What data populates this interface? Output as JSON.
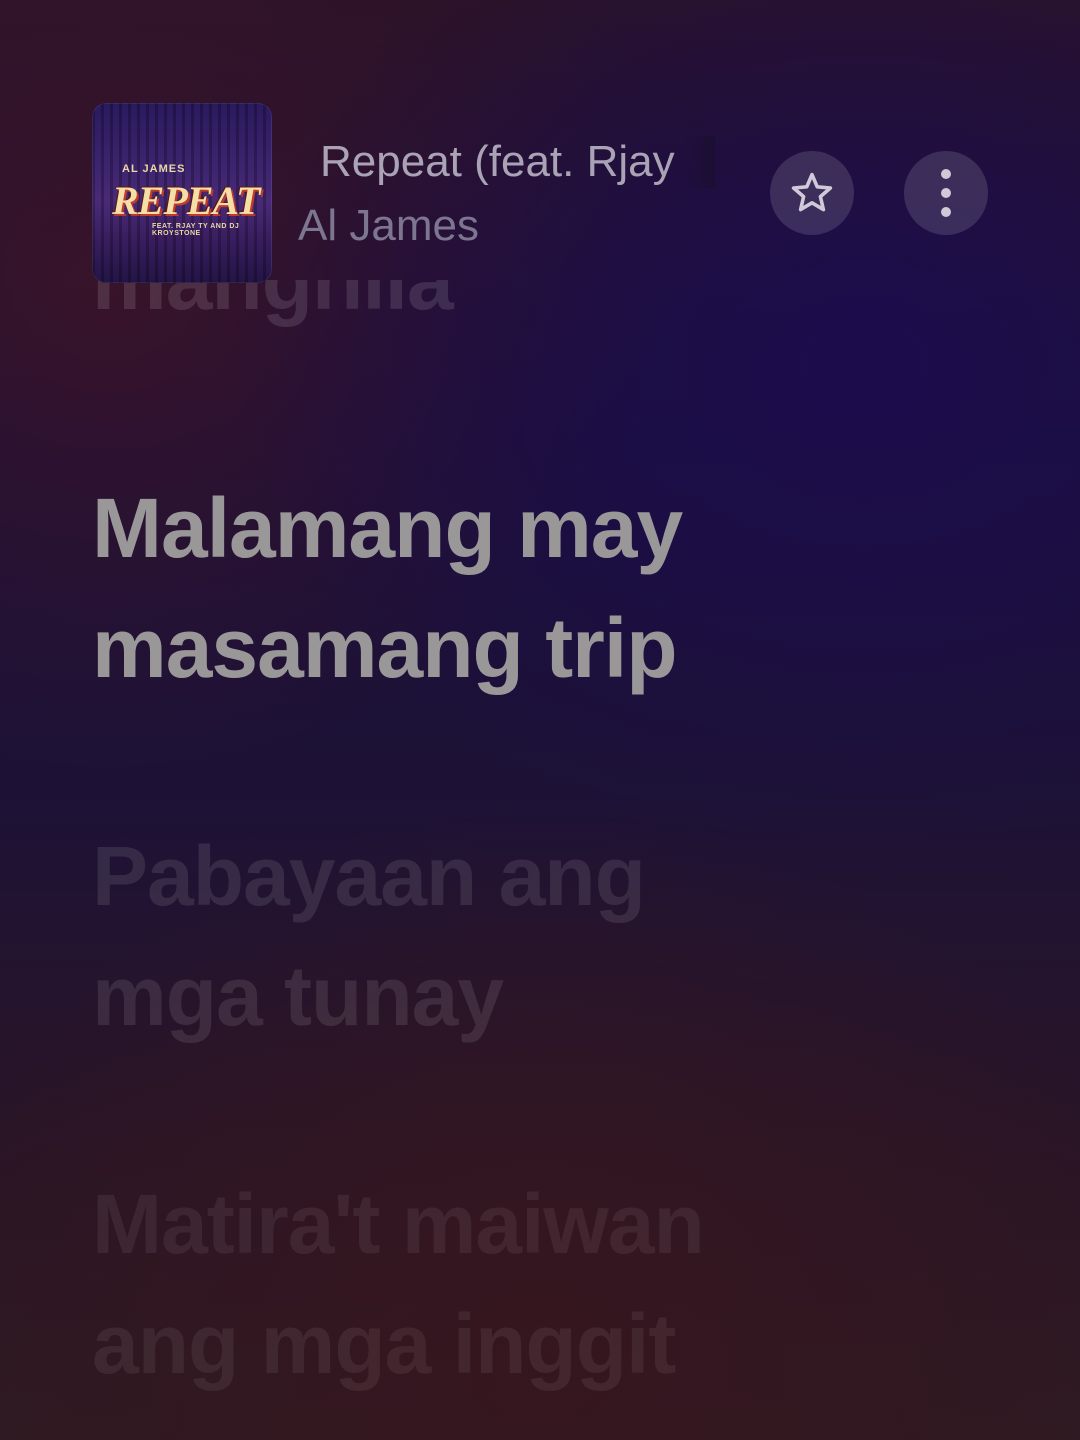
{
  "track": {
    "title": "Repeat (feat. Rjay",
    "artist": "Al James"
  },
  "album_art": {
    "top_text": "AL JAMES",
    "title_text": "REPEAT",
    "sub_text": "FEAT. RJAY TY AND DJ KROYSTONE"
  },
  "actions": {
    "favorite_icon": "star-outline-icon",
    "more_icon": "vertical-ellipsis-icon"
  },
  "lyrics": {
    "previous": {
      "lines": [
        "manghila"
      ]
    },
    "current": {
      "lines": [
        "Malamang may",
        "masamang trip"
      ]
    },
    "next_1": {
      "lines": [
        "Pabayaan ang",
        "mga tunay"
      ]
    },
    "next_2": {
      "lines": [
        "Matira't maiwan",
        "ang mga inggit"
      ]
    }
  },
  "colors": {
    "current_lyric": "#9a9799",
    "title": "#a9a3b5",
    "artist": "#7d7690"
  }
}
